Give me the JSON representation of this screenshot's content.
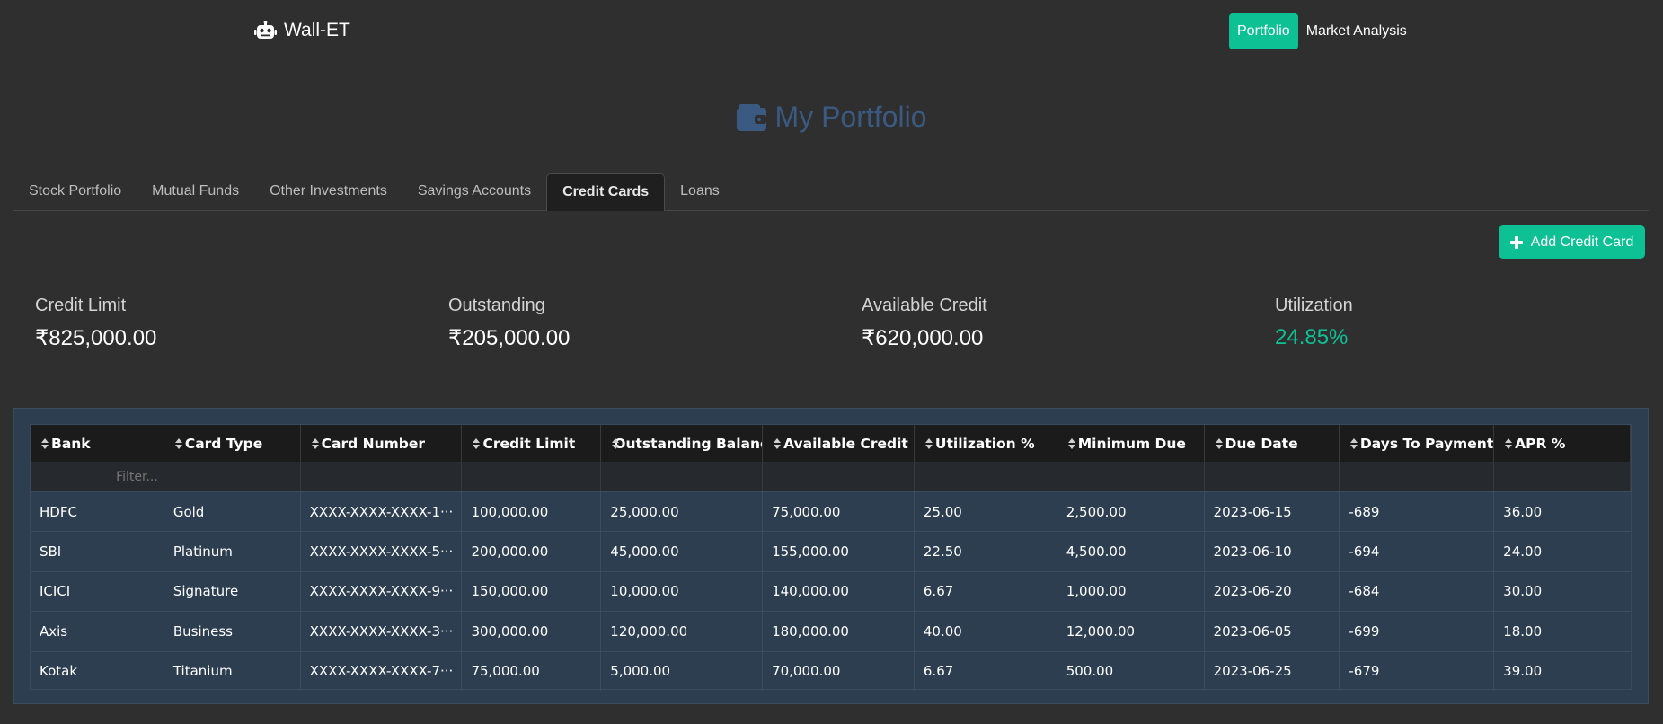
{
  "navbar": {
    "brand": "Wall-ET",
    "brand_icon": "robot-icon",
    "links": [
      {
        "label": "Portfolio",
        "active": true
      },
      {
        "label": "Market Analysis",
        "active": false
      }
    ]
  },
  "page": {
    "title": "My Portfolio",
    "title_icon": "wallet-icon"
  },
  "tabs": [
    {
      "label": "Stock Portfolio",
      "active": false
    },
    {
      "label": "Mutual Funds",
      "active": false
    },
    {
      "label": "Other Investments",
      "active": false
    },
    {
      "label": "Savings Accounts",
      "active": false
    },
    {
      "label": "Credit Cards",
      "active": true
    },
    {
      "label": "Loans",
      "active": false
    }
  ],
  "actions": {
    "add_label": "Add Credit Card",
    "add_icon": "plus-icon"
  },
  "summary": [
    {
      "label": "Credit Limit",
      "value": "₹825,000.00"
    },
    {
      "label": "Outstanding",
      "value": "₹205,000.00"
    },
    {
      "label": "Available Credit",
      "value": "₹620,000.00"
    },
    {
      "label": "Utilization",
      "value": "24.85%"
    }
  ],
  "colors": {
    "accent": "#0dc195",
    "title": "#3a5a82",
    "background": "#2f2f2f",
    "grid_background": "#2c3e50"
  },
  "table": {
    "columns": [
      "Bank",
      "Card Type",
      "Card Number",
      "Credit Limit",
      "Outstanding Balance",
      "Available Credit",
      "Utilization %",
      "Minimum Due",
      "Due Date",
      "Days To Payment",
      "APR %"
    ],
    "filter_placeholder": "Filter...",
    "rows": [
      [
        "HDFC",
        "Gold",
        "XXXX-XXXX-XXXX-1···",
        "100,000.00",
        "25,000.00",
        "75,000.00",
        "25.00",
        "2,500.00",
        "2023-06-15",
        "-689",
        "36.00"
      ],
      [
        "SBI",
        "Platinum",
        "XXXX-XXXX-XXXX-5···",
        "200,000.00",
        "45,000.00",
        "155,000.00",
        "22.50",
        "4,500.00",
        "2023-06-10",
        "-694",
        "24.00"
      ],
      [
        "ICICI",
        "Signature",
        "XXXX-XXXX-XXXX-9···",
        "150,000.00",
        "10,000.00",
        "140,000.00",
        "6.67",
        "1,000.00",
        "2023-06-20",
        "-684",
        "30.00"
      ],
      [
        "Axis",
        "Business",
        "XXXX-XXXX-XXXX-3···",
        "300,000.00",
        "120,000.00",
        "180,000.00",
        "40.00",
        "12,000.00",
        "2023-06-05",
        "-699",
        "18.00"
      ],
      [
        "Kotak",
        "Titanium",
        "XXXX-XXXX-XXXX-7···",
        "75,000.00",
        "5,000.00",
        "70,000.00",
        "6.67",
        "500.00",
        "2023-06-25",
        "-679",
        "39.00"
      ]
    ]
  }
}
